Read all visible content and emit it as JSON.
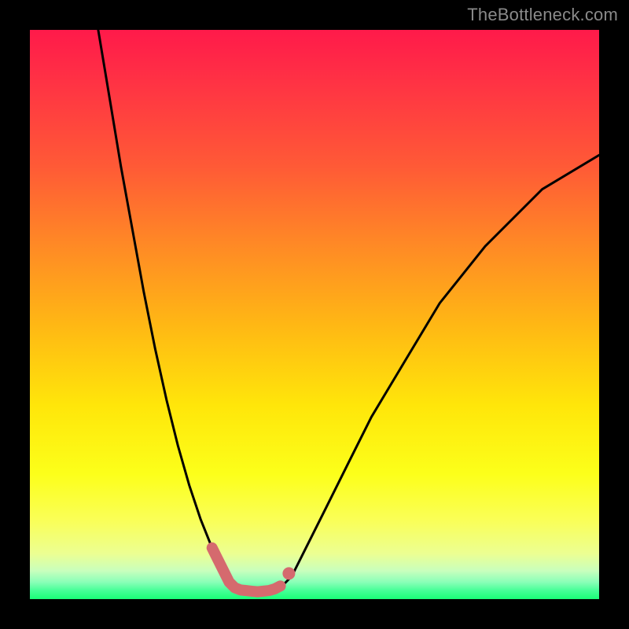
{
  "watermark": "TheBottleneck.com",
  "colors": {
    "curve_stroke": "#000000",
    "highlight_stroke": "#d56a6e",
    "highlight_dot": "#d56a6e",
    "bg_top": "#ff1a4a",
    "bg_bottom": "#1aff77",
    "frame": "#000000"
  },
  "chart_data": {
    "type": "line",
    "title": "",
    "xlabel": "",
    "ylabel": "",
    "xlim": [
      0,
      100
    ],
    "ylim": [
      0,
      100
    ],
    "note": "Axes have no tick labels in the screenshot; x/y are normalized 0–100 to describe the visible curve shape (bottleneck curve). Values are estimated from pixel positions.",
    "series": [
      {
        "name": "bottleneck-curve",
        "x": [
          12,
          14,
          16,
          18,
          20,
          22,
          24,
          26,
          28,
          30,
          32,
          34,
          35,
          36,
          38,
          40,
          42,
          44,
          46,
          48,
          52,
          56,
          60,
          66,
          72,
          80,
          90,
          100
        ],
        "y": [
          100,
          88,
          76,
          65,
          54,
          44,
          35,
          27,
          20,
          14,
          9,
          5,
          3,
          2,
          1.5,
          1.3,
          1.5,
          2,
          4,
          8,
          16,
          24,
          32,
          42,
          52,
          62,
          72,
          78
        ]
      }
    ],
    "highlight": {
      "name": "optimal-region",
      "x": [
        32,
        33,
        34,
        35,
        36,
        37,
        38,
        39,
        40,
        41,
        42,
        43,
        44
      ],
      "y": [
        9,
        7,
        5,
        3,
        2,
        1.6,
        1.5,
        1.4,
        1.3,
        1.4,
        1.5,
        1.8,
        2.3
      ],
      "dot": {
        "x": 45.5,
        "y": 4.5
      }
    }
  }
}
